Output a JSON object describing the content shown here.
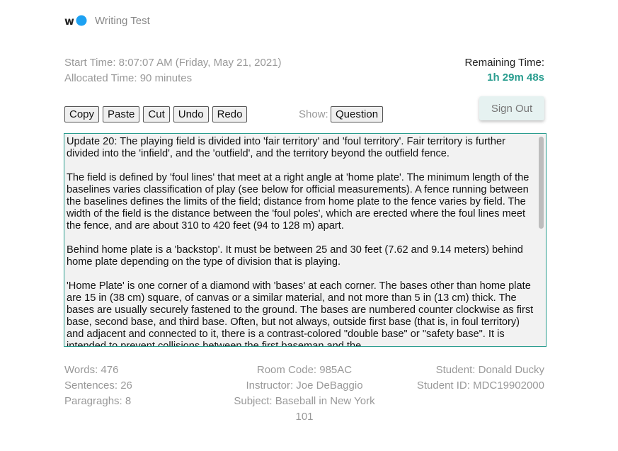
{
  "header": {
    "title": "Writing Test"
  },
  "colors": {
    "accent": "#2a9d8f",
    "logo_blue": "#1da1f2",
    "signout_bg": "#e6f2f1"
  },
  "times": {
    "start": "Start Time: 8:07:07 AM (Friday, May 21, 2021)",
    "allocated": "Allocated Time: 90 minutes",
    "remaining_label": "Remaining Time:",
    "remaining_value": "1h 29m 48s"
  },
  "toolbar": {
    "copy": "Copy",
    "paste": "Paste",
    "cut": "Cut",
    "undo": "Undo",
    "redo": "Redo"
  },
  "show": {
    "label": "Show:",
    "button": "Question"
  },
  "signout_label": "Sign Out",
  "editor": {
    "paragraphs": [
      "Update 20: The playing field is divided into 'fair territory' and 'foul territory'. Fair territory is further divided into the 'infield', and the 'outfield', and the territory beyond the outfield fence.",
      "The field is defined by 'foul lines' that meet at a right angle at 'home plate'. The minimum length of the baselines varies classification of play (see below for official measurements). A fence running between the baselines defines the limits of the field; distance from home plate to the fence varies by field. The width of the field is the distance between the 'foul poles', which are erected where the foul lines meet the fence, and are about 310 to 420 feet (94 to 128 m) apart.",
      "Behind home plate is a 'backstop'. It must be between 25 and 30 feet (7.62 and 9.14 meters) behind home plate depending on the type of division that is playing.",
      "'Home Plate' is one corner of a diamond with 'bases' at each corner. The bases other than home plate are 15 in (38 cm) square, of canvas or a similar material, and not more than 5 in (13 cm) thick. The bases are usually securely fastened to the ground. The bases are numbered counter clockwise as first base, second base, and third base. Often, but not always, outside first base (that is, in foul territory) and adjacent and connected to it, there is a contrast-colored \"double base\" or \"safety base\". It is intended to prevent collisions between the first baseman and the"
    ]
  },
  "stats": {
    "words": "Words: 476",
    "sentences": "Sentences: 26",
    "paragraphs": "Paragraghs: 8"
  },
  "info": {
    "room": "Room Code: 985AC",
    "instructor": "Instructor: Joe DeBaggio",
    "subject": "Subject: Baseball in New York 101"
  },
  "student": {
    "name": "Student: Donald Ducky",
    "id": "Student ID: MDC19902000"
  }
}
